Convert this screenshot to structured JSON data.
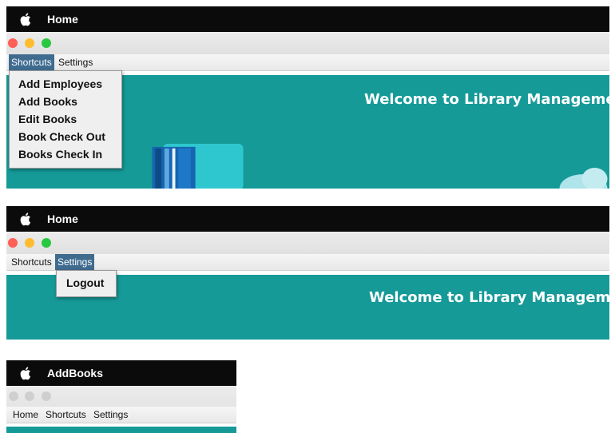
{
  "panel1": {
    "app_name": "Home",
    "menus": [
      "Shortcuts",
      "Settings"
    ],
    "active_menu": "Shortcuts",
    "dropdown": [
      "Add Employees",
      "Add Books",
      "Edit Books",
      "Book Check Out",
      "Books Check In"
    ],
    "welcome": "Welcome to Library Manageme"
  },
  "panel2": {
    "app_name": "Home",
    "menus": [
      "Shortcuts",
      "Settings"
    ],
    "active_menu": "Settings",
    "dropdown": [
      "Logout"
    ],
    "welcome": "Welcome to Library Managem"
  },
  "panel3": {
    "app_name": "AddBooks",
    "menus": [
      "Home",
      "Shortcuts",
      "Settings"
    ]
  },
  "colors": {
    "titlebar": "#0b0b0b",
    "content_teal": "#159a98",
    "menu_highlight": "#3f6b8f",
    "traffic_red": "#fe5f57",
    "traffic_yellow": "#febc2e",
    "traffic_green": "#28c840",
    "traffic_inactive": "#cfcfcf"
  },
  "icons": [
    "apple-logo-icon",
    "book-icon",
    "cloud-icon"
  ]
}
